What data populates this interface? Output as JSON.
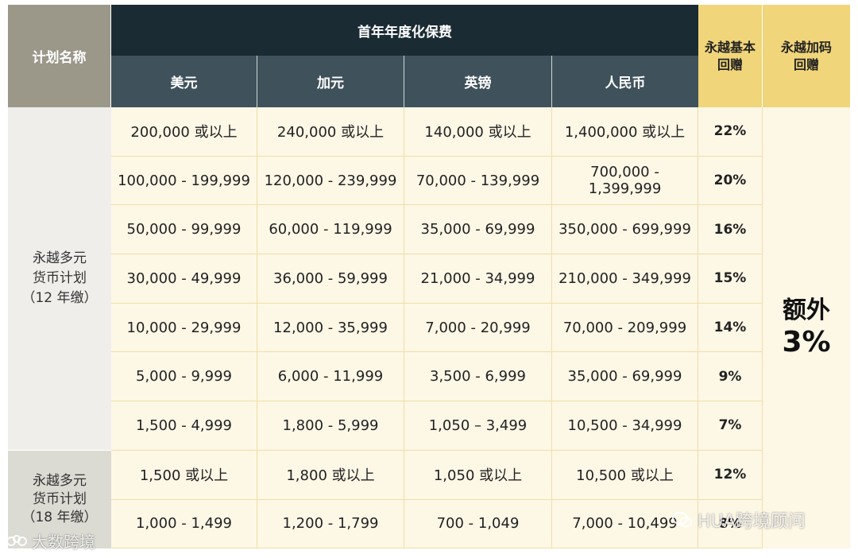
{
  "headers": {
    "plan_name": "计划名称",
    "premium_group": "首年年度化保费",
    "currencies": [
      "美元",
      "加元",
      "英镑",
      "人民币"
    ],
    "base_bonus": [
      "永越基本",
      "回赠"
    ],
    "extra_bonus": [
      "永越加码",
      "回赠"
    ]
  },
  "plans": [
    {
      "lines": [
        "永越多元",
        "货币计划",
        "（12 年缴）"
      ]
    },
    {
      "lines": [
        "永越多元",
        "货币计划",
        "（18 年缴）"
      ]
    }
  ],
  "rows": [
    {
      "usd": "200,000 或以上",
      "cad": "240,000 或以上",
      "gbp": "140,000 或以上",
      "rmb": "1,400,000 或以上",
      "base": "22%"
    },
    {
      "usd": "100,000 - 199,999",
      "cad": "120,000 - 239,999",
      "gbp": "70,000 - 139,999",
      "rmb": "700,000 - 1,399,999",
      "base": "20%"
    },
    {
      "usd": "50,000 - 99,999",
      "cad": "60,000 - 119,999",
      "gbp": "35,000 - 69,999",
      "rmb": "350,000 - 699,999",
      "base": "16%"
    },
    {
      "usd": "30,000 - 49,999",
      "cad": "36,000 - 59,999",
      "gbp": "21,000 - 34,999",
      "rmb": "210,000 - 349,999",
      "base": "15%"
    },
    {
      "usd": "10,000 - 29,999",
      "cad": "12,000 - 35,999",
      "gbp": "7,000 - 20,999",
      "rmb": "70,000 - 209,999",
      "base": "14%"
    },
    {
      "usd": "5,000 - 9,999",
      "cad": "6,000 - 11,999",
      "gbp": "3,500 - 6,999",
      "rmb": "35,000 - 69,999",
      "base": "9%"
    },
    {
      "usd": "1,500 - 4,999",
      "cad": "1,800 - 5,999",
      "gbp": "1,050 – 3,499",
      "rmb": "10,500 - 34,999",
      "base": "7%"
    },
    {
      "usd": "1,500 或以上",
      "cad": "1,800 或以上",
      "gbp": "1,050 或以上",
      "rmb": "10,500 或以上",
      "base": "12%"
    },
    {
      "usd": "1,000 - 1,499",
      "cad": "1,200 - 1,799",
      "gbp": "700 - 1,049",
      "rmb": "7,000 - 10,499",
      "base": "8%"
    }
  ],
  "extra": {
    "line1": "额外",
    "line2": "3%"
  },
  "watermarks": {
    "left": "大数跨境",
    "right": "HUA跨境顾问"
  },
  "colors": {
    "header_dark": "#1b2b34",
    "header_sub": "#3f525b",
    "header_grey": "#9b988a",
    "gold": "#f0d57a",
    "cell_bg": "#fdf7e6"
  }
}
